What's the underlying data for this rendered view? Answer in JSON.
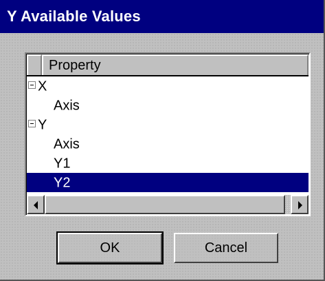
{
  "window": {
    "title": "Y Available Values"
  },
  "list": {
    "column_header": "Property",
    "rows": [
      {
        "label": "X",
        "level": 0,
        "expanded": true,
        "selected": false
      },
      {
        "label": "Axis",
        "level": 1,
        "selected": false
      },
      {
        "label": "Y",
        "level": 0,
        "expanded": true,
        "selected": false
      },
      {
        "label": "Axis",
        "level": 1,
        "selected": false
      },
      {
        "label": "Y1",
        "level": 1,
        "selected": false
      },
      {
        "label": "Y2",
        "level": 1,
        "selected": true
      }
    ]
  },
  "buttons": {
    "ok_label": "OK",
    "cancel_label": "Cancel"
  },
  "colors": {
    "titlebar": "#000080",
    "selection": "#000080",
    "face": "#c0c0c0"
  },
  "icons": {
    "expander": "collapse-minus-icon",
    "scroll_left": "arrow-left-icon",
    "scroll_right": "arrow-right-icon"
  }
}
